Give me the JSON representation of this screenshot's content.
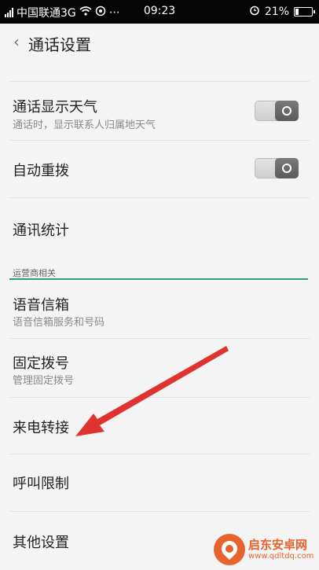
{
  "status_bar": {
    "carrier": "中国联通3G",
    "extra": "⋯",
    "time": "09:23",
    "battery": "21%",
    "battery_level": 0.21
  },
  "header": {
    "title": "通话设置"
  },
  "settings": [
    {
      "title": "通话显示天气",
      "subtitle": "通话时，显示联系人归属地天气",
      "toggle": "on"
    },
    {
      "title": "自动重拨",
      "toggle": "on"
    },
    {
      "title": "通讯统计"
    }
  ],
  "section": {
    "label": "运营商相关"
  },
  "carrier_settings": [
    {
      "title": "语音信箱",
      "subtitle": "语音信箱服务和号码"
    },
    {
      "title": "固定拨号",
      "subtitle": "管理固定拨号"
    },
    {
      "title": "来电转接"
    },
    {
      "title": "呼叫限制"
    },
    {
      "title": "其他设置"
    }
  ],
  "watermark": {
    "name": "启东安卓网",
    "url": "www.qdltdq.com"
  },
  "colors": {
    "accent": "#2e9e71",
    "annotation": "#e0322e",
    "watermark": "#e8622c"
  }
}
